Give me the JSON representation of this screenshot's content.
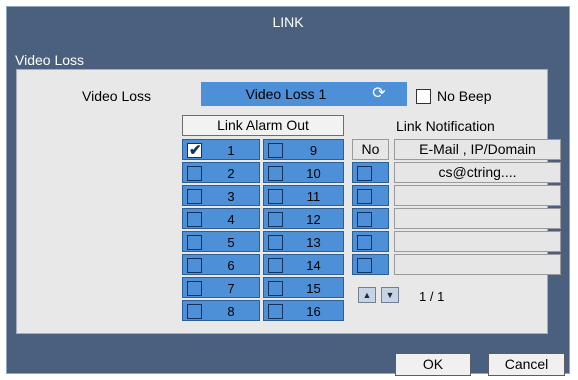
{
  "window": {
    "title": "LINK"
  },
  "section": {
    "title": "Video Loss"
  },
  "video_loss": {
    "label": "Video Loss",
    "selected": "Video Loss 1",
    "no_beep": {
      "label": "No Beep",
      "checked": false
    }
  },
  "link_alarm_out": {
    "header": "Link Alarm Out",
    "left": [
      {
        "num": "1",
        "checked": true
      },
      {
        "num": "2",
        "checked": false
      },
      {
        "num": "3",
        "checked": false
      },
      {
        "num": "4",
        "checked": false
      },
      {
        "num": "5",
        "checked": false
      },
      {
        "num": "6",
        "checked": false
      },
      {
        "num": "7",
        "checked": false
      },
      {
        "num": "8",
        "checked": false
      }
    ],
    "right": [
      {
        "num": "9",
        "checked": false
      },
      {
        "num": "10",
        "checked": false
      },
      {
        "num": "11",
        "checked": false
      },
      {
        "num": "12",
        "checked": false
      },
      {
        "num": "13",
        "checked": false
      },
      {
        "num": "14",
        "checked": false
      },
      {
        "num": "15",
        "checked": false
      },
      {
        "num": "16",
        "checked": false
      }
    ]
  },
  "link_notification": {
    "header": "Link Notification",
    "col_no": "No",
    "col_target": "E-Mail , IP/Domain",
    "rows": [
      "cs@ctring....",
      "",
      "",
      "",
      ""
    ],
    "page": "1 / 1"
  },
  "buttons": {
    "ok": "OK",
    "cancel": "Cancel"
  },
  "icons": {
    "refresh": "refresh-icon",
    "check": "checkmark-icon",
    "up": "arrow-up-icon",
    "down": "arrow-down-icon"
  },
  "colors": {
    "window_bg": "#4a607e",
    "panel_bg": "#e8e8e8",
    "accent_blue": "#4d90d8"
  }
}
